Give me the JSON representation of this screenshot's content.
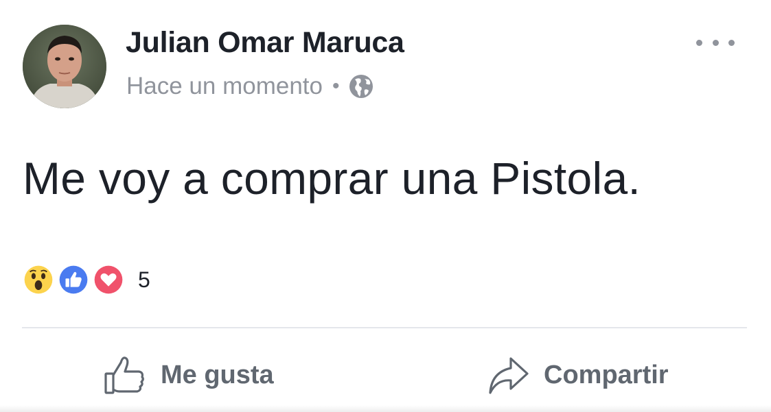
{
  "post": {
    "author_name": "Julian Omar Maruca",
    "timestamp": "Hace un momento",
    "separator": "•",
    "privacy_icon": "globe-icon",
    "more_icon": "more-options-icon",
    "text": "Me voy a comprar una Pistola.",
    "reactions": {
      "icons": [
        "wow-reaction-icon",
        "like-reaction-icon",
        "love-reaction-icon"
      ],
      "count": "5"
    },
    "actions": {
      "like_label": "Me gusta",
      "share_label": "Compartir"
    }
  },
  "colors": {
    "like_blue": "#4a7bf0",
    "love_red": "#f0526b",
    "wow_yellow": "#fcd34d",
    "secondary_text": "#90949c",
    "action_text": "#606770"
  }
}
